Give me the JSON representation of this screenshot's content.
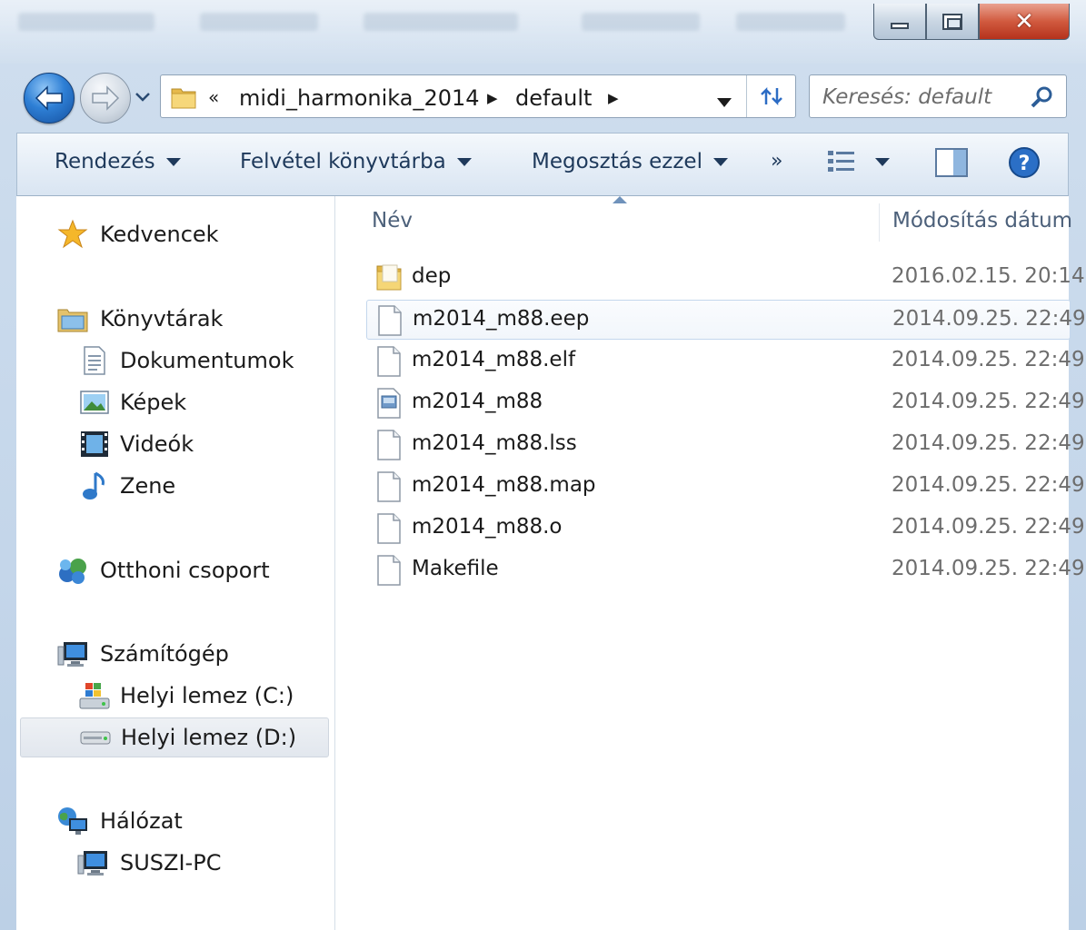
{
  "window": {
    "caption": {
      "minimize": "minimize",
      "maximize": "maximize",
      "close": "close"
    }
  },
  "navigation": {
    "back": "back",
    "forward": "forward"
  },
  "address": {
    "overflow": "«",
    "crumbs": [
      "midi_harmonika_2014",
      "default"
    ]
  },
  "search": {
    "placeholder": "Keresés: default"
  },
  "toolbar": {
    "organize": "Rendezés",
    "include_in_library": "Felvétel könyvtárba",
    "share_with": "Megosztás ezzel",
    "more": "»"
  },
  "sidebar": {
    "favorites": "Kedvencek",
    "libraries": "Könyvtárak",
    "documents": "Dokumentumok",
    "pictures": "Képek",
    "videos": "Videók",
    "music": "Zene",
    "homegroup": "Otthoni csoport",
    "computer": "Számítógép",
    "drive_c": "Helyi lemez (C:)",
    "drive_d": "Helyi lemez (D:)",
    "network": "Hálózat",
    "pc": "SUSZI-PC"
  },
  "columns": {
    "name": "Név",
    "modified": "Módosítás dátum"
  },
  "files": [
    {
      "name": "dep",
      "date": "2016.02.15. 20:14",
      "icon": "folder-icon"
    },
    {
      "name": "m2014_m88.eep",
      "date": "2014.09.25. 22:49",
      "icon": "file-icon"
    },
    {
      "name": "m2014_m88.elf",
      "date": "2014.09.25. 22:49",
      "icon": "file-icon"
    },
    {
      "name": "m2014_m88",
      "date": "2014.09.25. 22:49",
      "icon": "hex-file-icon"
    },
    {
      "name": "m2014_m88.lss",
      "date": "2014.09.25. 22:49",
      "icon": "file-icon"
    },
    {
      "name": "m2014_m88.map",
      "date": "2014.09.25. 22:49",
      "icon": "file-icon"
    },
    {
      "name": "m2014_m88.o",
      "date": "2014.09.25. 22:49",
      "icon": "file-icon"
    },
    {
      "name": "Makefile",
      "date": "2014.09.25. 22:49",
      "icon": "file-icon"
    }
  ],
  "colors": {
    "toolbar_text": "#1e395b",
    "selection_border": "#c4d7ed",
    "date_text": "#6d6d6d"
  }
}
